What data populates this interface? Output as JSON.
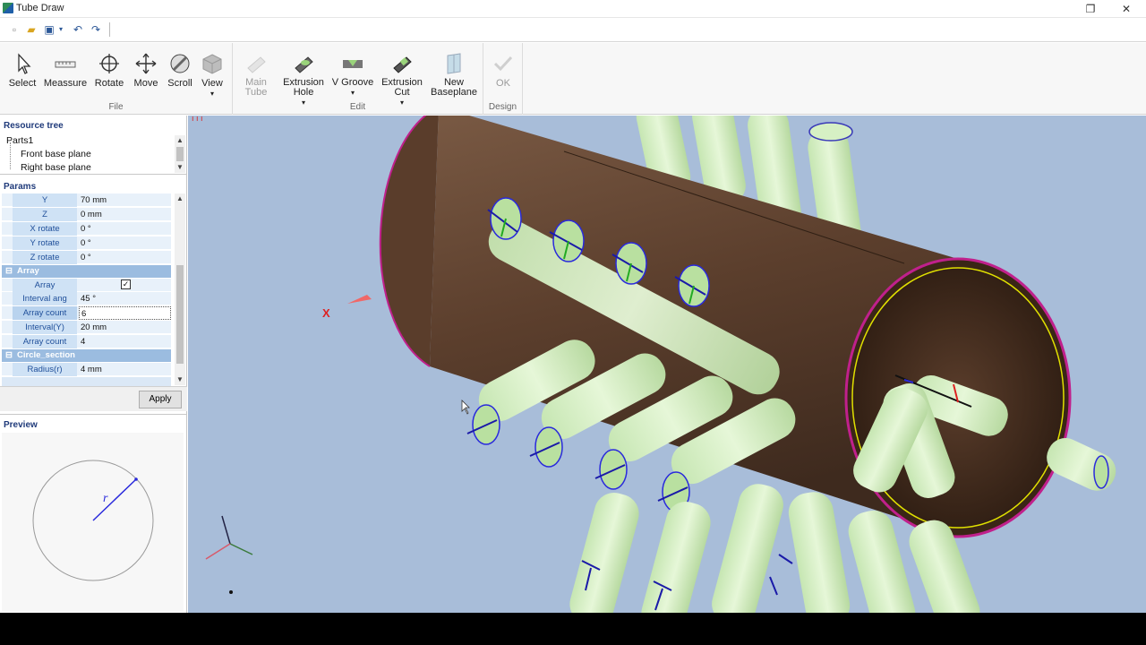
{
  "window": {
    "title": "Tube Draw"
  },
  "ribbon": {
    "groups": [
      {
        "label": "File",
        "buttons": [
          {
            "label": "Select",
            "icon": "cursor-icon"
          },
          {
            "label": "Meassure",
            "icon": "ruler-icon"
          },
          {
            "label": "Rotate",
            "icon": "rotate-icon"
          },
          {
            "label": "Move",
            "icon": "move-icon"
          },
          {
            "label": "Scroll",
            "icon": "scroll-icon"
          },
          {
            "label": "View",
            "icon": "cube-icon"
          }
        ]
      },
      {
        "label": "Edit",
        "buttons": [
          {
            "label": "Main",
            "label2": "Tube",
            "icon": "main-tube-icon",
            "disabled": true
          },
          {
            "label": "Extrusion",
            "label2": "Hole",
            "icon": "extrusion-hole-icon"
          },
          {
            "label": "V Groove",
            "icon": "v-groove-icon"
          },
          {
            "label": "Extrusion",
            "label2": "Cut",
            "icon": "extrusion-cut-icon"
          },
          {
            "label": "New",
            "label2": "Baseplane",
            "icon": "baseplane-icon"
          }
        ]
      },
      {
        "label": "Design",
        "buttons": [
          {
            "label": "OK",
            "icon": "check-icon",
            "disabled": true
          }
        ]
      }
    ]
  },
  "resource_tree": {
    "title": "Resource tree",
    "root": "Parts1",
    "items": [
      "Front base plane",
      "Right base plane"
    ]
  },
  "params": {
    "title": "Params",
    "rows": [
      {
        "name": "Y",
        "value": "70 mm"
      },
      {
        "name": "Z",
        "value": "0 mm"
      },
      {
        "name": "X rotate",
        "value": "0 °"
      },
      {
        "name": "Y rotate",
        "value": "0 °"
      },
      {
        "name": "Z rotate",
        "value": "0 °"
      }
    ],
    "array_group": "Array",
    "array_rows": [
      {
        "name": "Array",
        "value": "",
        "checked": true
      },
      {
        "name": "Interval ang",
        "value": "45 °"
      },
      {
        "name": "Array count",
        "value": "6"
      },
      {
        "name": "Interval(Y)",
        "value": "20 mm"
      },
      {
        "name": "Array count",
        "value": "4"
      }
    ],
    "circle_group": "Circle_section",
    "circle_rows": [
      {
        "name": "Radius(r)",
        "value": "4 mm"
      }
    ],
    "apply_label": "Apply",
    "group_toggle": "⊟"
  },
  "preview": {
    "title": "Preview",
    "radius_label": "r"
  },
  "viewport": {
    "axis_label_x": "X",
    "axis_mark": "ı ı ı"
  },
  "colors": {
    "tube_body": "#5a3d2b",
    "pipe": "#d6f0c4",
    "viewport_bg": "#a8bdd9",
    "section_outline": "#e0e000",
    "section_rim": "#c0208c"
  }
}
